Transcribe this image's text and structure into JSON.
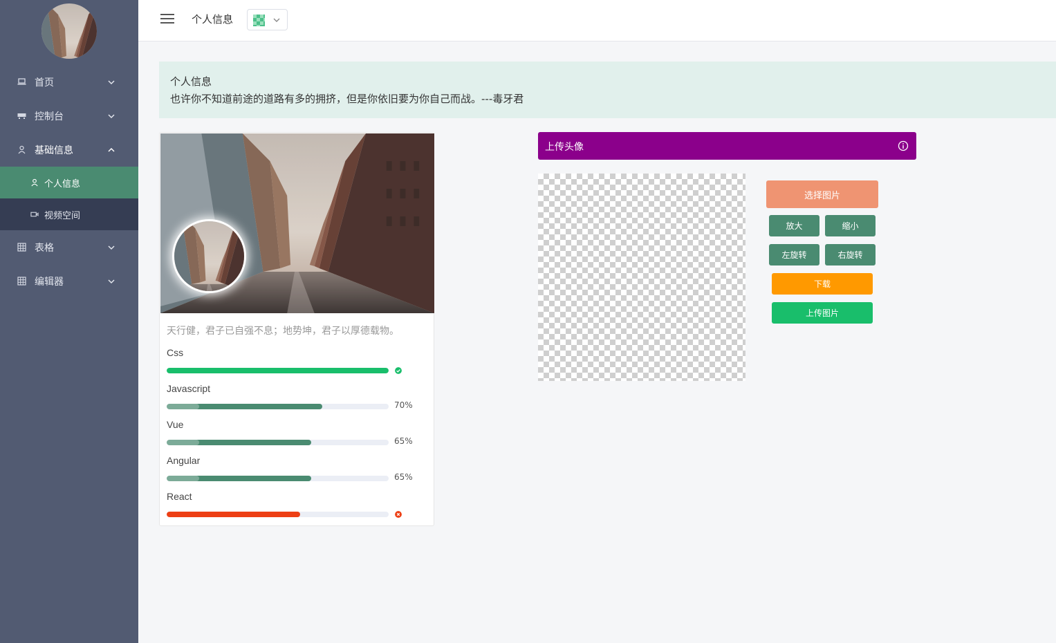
{
  "colors": {
    "sidebar_bg": "#525b72",
    "submenu_bg": "#353d53",
    "active_item": "#4a8b71",
    "banner_bg": "#e1f0ec",
    "upload_bar": "#8b008b",
    "success": "#19be6b",
    "primary_bar": "#4a8b71",
    "error": "#ed3f14",
    "warning": "#ff9900",
    "choose_button": "#ef9472"
  },
  "sidebar": {
    "items": [
      {
        "label": "首页",
        "icon": "laptop-icon"
      },
      {
        "label": "控制台",
        "icon": "monitor-icon"
      },
      {
        "label": "基础信息",
        "icon": "person-icon",
        "expanded": true,
        "children": [
          {
            "label": "个人信息",
            "icon": "person-icon",
            "active": true
          },
          {
            "label": "视频空间",
            "icon": "video-camera-icon"
          }
        ]
      },
      {
        "label": "表格",
        "icon": "grid-icon"
      },
      {
        "label": "编辑器",
        "icon": "grid-icon"
      }
    ]
  },
  "header": {
    "title": "个人信息"
  },
  "banner": {
    "title": "个人信息",
    "quote": "也许你不知道前途的道路有多的拥挤，但是你依旧要为你自己而战。---毒牙君"
  },
  "profile": {
    "motto": "天行健，君子已自强不息；地势坤，君子以厚德载物。",
    "skills": [
      {
        "name": "Css",
        "percent": 100,
        "status": "success"
      },
      {
        "name": "Javascript",
        "percent": 70,
        "label": "70%",
        "status": "active"
      },
      {
        "name": "Vue",
        "percent": 65,
        "label": "65%",
        "status": "active"
      },
      {
        "name": "Angular",
        "percent": 65,
        "label": "65%",
        "status": "active"
      },
      {
        "name": "React",
        "percent": 60,
        "status": "error"
      }
    ]
  },
  "upload": {
    "title": "上传头像",
    "buttons": {
      "choose": "选择图片",
      "zoom_in": "放大",
      "zoom_out": "缩小",
      "rotate_left": "左旋转",
      "rotate_right": "右旋转",
      "download": "下载",
      "upload": "上传图片"
    }
  }
}
